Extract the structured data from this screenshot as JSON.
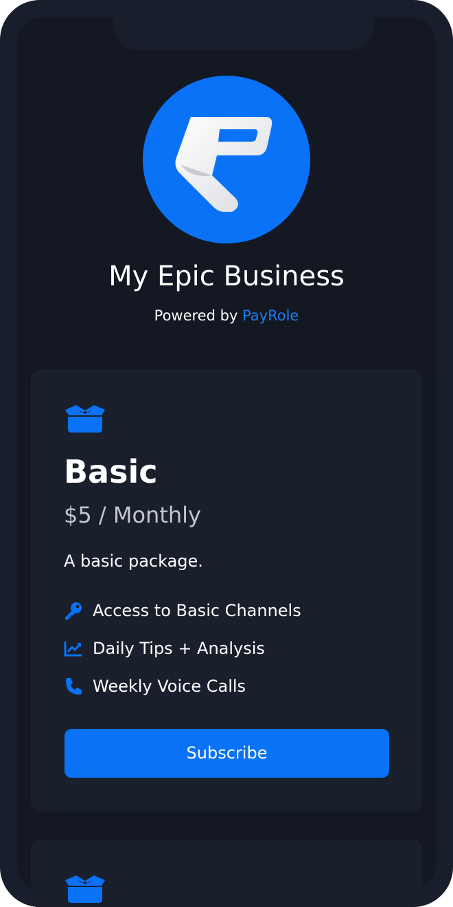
{
  "business": {
    "name": "My Epic Business",
    "powered_prefix": "Powered by",
    "powered_brand": "PayRole",
    "logo_icon": "payrole-logo"
  },
  "plans": [
    {
      "icon": "box-open-icon",
      "name": "Basic",
      "price": "$5 / Monthly",
      "description": "A basic package.",
      "features": [
        {
          "icon": "key-icon",
          "label": "Access to Basic Channels"
        },
        {
          "icon": "chart-line-icon",
          "label": "Daily Tips + Analysis"
        },
        {
          "icon": "phone-icon",
          "label": "Weekly Voice Calls"
        }
      ],
      "button_label": "Subscribe"
    },
    {
      "icon": "box-open-icon"
    }
  ],
  "colors": {
    "accent": "#0a72f6",
    "brand_text": "#1d7cf2",
    "background": "#131822",
    "card": "#1a1f2c",
    "frame": "#181e2b"
  }
}
